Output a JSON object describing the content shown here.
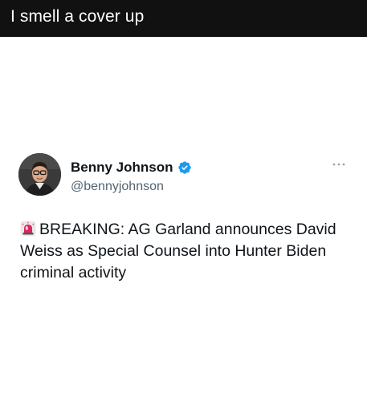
{
  "caption": {
    "text": "I smell a cover up"
  },
  "tweet": {
    "author": {
      "name": "Benny Johnson",
      "handle": "@bennyjohnson",
      "verified": true,
      "avatar_icon": "profile-photo"
    },
    "body": {
      "emoji_icon": "police-siren-icon",
      "text": "BREAKING: AG Garland announces David Weiss as Special Counsel into Hunter Biden criminal activity"
    },
    "menu_icon": "more-options-icon"
  },
  "colors": {
    "caption_background": "#111111",
    "caption_text": "#ffffff",
    "verified_badge": "#1d9bf0",
    "handle_text": "#536471",
    "body_text": "#0f1419",
    "siren": "#e0245e"
  }
}
